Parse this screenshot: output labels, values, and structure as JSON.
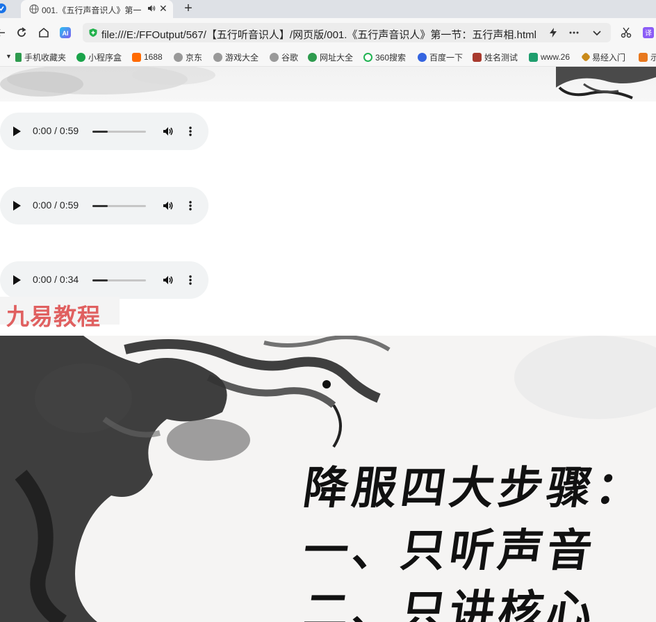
{
  "browser": {
    "tab": {
      "title": "001.《五行声音识人》第一"
    },
    "address_bar": {
      "url": "file:///E:/FFOutput/567/【五行听音识人】/网页版/001.《五行声音识人》第一节：五行声相.html"
    },
    "bookmarks": [
      {
        "label": "手机收藏夹",
        "icon": "phone-icon",
        "color": "#2e9b4e"
      },
      {
        "label": "小程序盒",
        "icon": "shield-icon",
        "color": "#1aa34a"
      },
      {
        "label": "1688",
        "icon": "1688-icon",
        "color": "#ff6a00"
      },
      {
        "label": "京东",
        "icon": "globe-icon",
        "color": "#888888"
      },
      {
        "label": "游戏大全",
        "icon": "globe-icon",
        "color": "#888888"
      },
      {
        "label": "谷歌",
        "icon": "globe-icon",
        "color": "#888888"
      },
      {
        "label": "网址大全",
        "icon": "hao-icon",
        "color": "#2e9b4e"
      },
      {
        "label": "360搜索",
        "icon": "search360-icon",
        "color": "#21b352"
      },
      {
        "label": "百度一下",
        "icon": "baidu-paw-icon",
        "color": "#3464e0"
      },
      {
        "label": "姓名测试",
        "icon": "name-test-icon",
        "color": "#a83a2e"
      },
      {
        "label": "www.26",
        "icon": "site-icon",
        "color": "#1f9e6e"
      },
      {
        "label": "易经入门",
        "icon": "yijing-icon",
        "color": "#c98a1a"
      },
      {
        "label": "示",
        "icon": "plus-icon",
        "color": "#e8781e"
      }
    ]
  },
  "audio_players": [
    {
      "time": "0:00 / 0:59"
    },
    {
      "time": "0:00 / 0:59"
    },
    {
      "time": "0:00 / 0:34"
    }
  ],
  "watermark": {
    "text": "九易教程"
  },
  "poster": {
    "lines": [
      "降服四大步骤：",
      "一、只听声音",
      "二、只讲核心"
    ]
  },
  "colors": {
    "tab_bar": "#dee1e6",
    "toolbar": "#f7f7f7",
    "audio_bg": "#f1f3f4",
    "watermark": "#e06060"
  }
}
